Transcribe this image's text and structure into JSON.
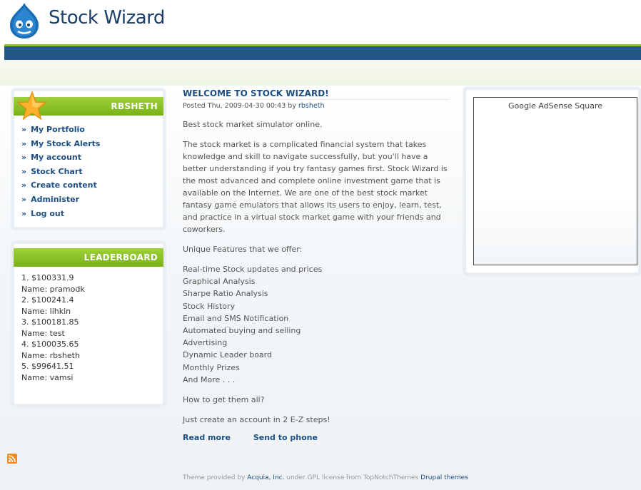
{
  "site": {
    "name": "Stock Wizard"
  },
  "user_block": {
    "title": "RBSHETH",
    "menu": [
      "My Portfolio",
      "My Stock Alerts",
      "My account",
      "Stock Chart",
      "Create content",
      "Administer",
      "Log out"
    ],
    "bullet": "»"
  },
  "leaderboard": {
    "title": "LEADERBOARD",
    "entries": [
      "1. $100331.9",
      "Name: pramodk",
      "2. $100241.4",
      "Name: lihkin",
      "3. $100181.85",
      "Name: test",
      "4. $100035.65",
      "Name: rbsheth",
      "5. $99641.51",
      "Name: vamsi"
    ]
  },
  "node": {
    "title": "WELCOME TO STOCK WIZARD!",
    "submitted_prefix": "Posted Thu, 2009-04-30 00:43 by",
    "author": "rbsheth",
    "intro": "Best stock market simulator online.",
    "body": "The stock market is a complicated financial system that takes knowledge and skill to navigate successfully, but you'll have a better understanding if you try fantasy games first. Stock Wizard is the most advanced and complete online investment game that is available on the Internet. We are one of the best stock market fantasy game emulators that allows its users to enjoy, learn, test, and practice in a virtual stock market game with your friends and coworkers.",
    "features_intro": "Unique Features that we offer:",
    "features": [
      "Real-time Stock updates and prices",
      "Graphical Analysis",
      "Sharpe Ratio Analysis",
      "Stock History",
      "Email and SMS Notification",
      "Automated buying and selling",
      "Advertising",
      "Dynamic Leader board",
      "Monthly Prizes",
      "And More . . ."
    ],
    "question": "How to get them all?",
    "cta": "Just create an account in 2 E-Z steps!",
    "read_more": "Read more",
    "send_to_phone": "Send to phone"
  },
  "ad": {
    "label": "Google AdSense Square"
  },
  "footer": {
    "prefix": "Theme provided by",
    "acquia": "Acquia, Inc.",
    "middle": "under GPL license from TopNotchThemes",
    "drupal": "Drupal themes"
  },
  "icons": {
    "logo": "drupal-drop-icon",
    "star": "star-icon",
    "rss": "rss-feed-icon"
  },
  "colors": {
    "nav_blue": "#245787",
    "accent_green": "#79b217",
    "link_blue": "#1d4f85"
  }
}
